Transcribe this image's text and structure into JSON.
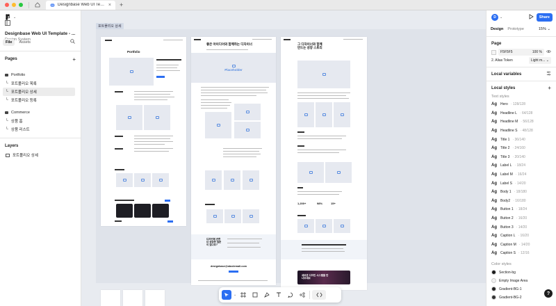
{
  "titlebar": {
    "tab_title": "Designbase Web UI Template - v",
    "close": "×",
    "new_tab": "+"
  },
  "left_panel": {
    "project_title": "Designbase Web UI Template - ...",
    "project_subtitle": "Design System",
    "tabs": [
      "File",
      "Assets"
    ],
    "pages_title": "Pages",
    "pages": [
      {
        "label": "Portfolio",
        "type": "group"
      },
      {
        "label": "포트폴리오 목록",
        "type": "page"
      },
      {
        "label": "포트폴리오 상세",
        "type": "page",
        "selected": true
      },
      {
        "label": "포트폴리오 등록",
        "type": "page"
      },
      {
        "label": "Commerce",
        "type": "group"
      },
      {
        "label": "상품 홈",
        "type": "page"
      },
      {
        "label": "상품 리스트",
        "type": "page"
      }
    ],
    "layers_title": "Layers",
    "layers": [
      "포트폴리오 상세"
    ]
  },
  "canvas": {
    "section_label": "포트폴리오 상세",
    "frame1_title": "Portfolio",
    "frame2_title": "좋은 아이디어와 함께하는 디자이너",
    "frame2_placeholder": "Placeholder",
    "frame3_title": "그 디자이너와 함께 만드는 성장 스토리",
    "frame3_stats": [
      "1,200+",
      "98%",
      "15+"
    ],
    "frame2_contact_title": "디자인에 관한 더 궁금한 질문이 있나요?",
    "frame2_email": "designbase@abcdemail.com",
    "frame3_banner_text": "새로운 디자인 시스템을 만나보세요"
  },
  "toolbar": {
    "tools": [
      "move-tool",
      "frame-tool",
      "shape-tool",
      "pen-tool",
      "text-tool",
      "comment-tool",
      "actions-tool",
      "dev-mode-tool"
    ]
  },
  "right_panel": {
    "avatar": "D",
    "share_label": "Share",
    "tabs": [
      "Design",
      "Prototype"
    ],
    "zoom": "15%",
    "page_section": "Page",
    "page_color": "F5F5F5",
    "page_opacity": "100",
    "page_opacity_unit": "%",
    "mode_label": "2. Alias Token",
    "mode_value": "Light m...",
    "local_variables": "Local variables",
    "local_styles": "Local styles",
    "text_styles_title": "Text styles",
    "text_styles": [
      {
        "ag": "Ag",
        "name": "Hero",
        "meta": "· 128/128"
      },
      {
        "ag": "Ag",
        "name": "Headline L",
        "meta": "· 64/128"
      },
      {
        "ag": "Ag",
        "name": "Headline M",
        "meta": "· 56/128"
      },
      {
        "ag": "Ag",
        "name": "Headline S",
        "meta": "· 48/128"
      },
      {
        "ag": "Ag",
        "name": "Title 1",
        "meta": "· 36/140"
      },
      {
        "ag": "Ag",
        "name": "Title 2",
        "meta": "· 24/160"
      },
      {
        "ag": "Ag",
        "name": "Title 3",
        "meta": "· 20/140"
      },
      {
        "ag": "Ag",
        "name": "Label L",
        "meta": "· 18/24"
      },
      {
        "ag": "Ag",
        "name": "Label M",
        "meta": "· 16/24"
      },
      {
        "ag": "Ag",
        "name": "Label S",
        "meta": "· 14/20"
      },
      {
        "ag": "Ag",
        "name": "Body 1",
        "meta": "· 18/180"
      },
      {
        "ag": "Ag",
        "name": "Body2",
        "meta": "· 16/180"
      },
      {
        "ag": "Ag",
        "name": "Button 1",
        "meta": "· 18/24"
      },
      {
        "ag": "Ag",
        "name": "Button 2",
        "meta": "· 16/20"
      },
      {
        "ag": "Ag",
        "name": "Button 3",
        "meta": "· 14/20"
      },
      {
        "ag": "Ag",
        "name": "Caption L",
        "meta": "· 16/20"
      },
      {
        "ag": "Ag",
        "name": "Caption M",
        "meta": "· 14/20"
      },
      {
        "ag": "Ag",
        "name": "Caption S",
        "meta": "· 12/16"
      }
    ],
    "color_styles_title": "Color styles",
    "color_styles": [
      {
        "name": "Section-bg",
        "color": "#1a1a1a"
      },
      {
        "name": "Empty Image Area",
        "color": "#f0f0f0"
      },
      {
        "name": "Gradient-BG-1",
        "color": "#222222"
      },
      {
        "name": "Gradient-BG-2",
        "color": "#333333"
      }
    ],
    "help": "?"
  }
}
